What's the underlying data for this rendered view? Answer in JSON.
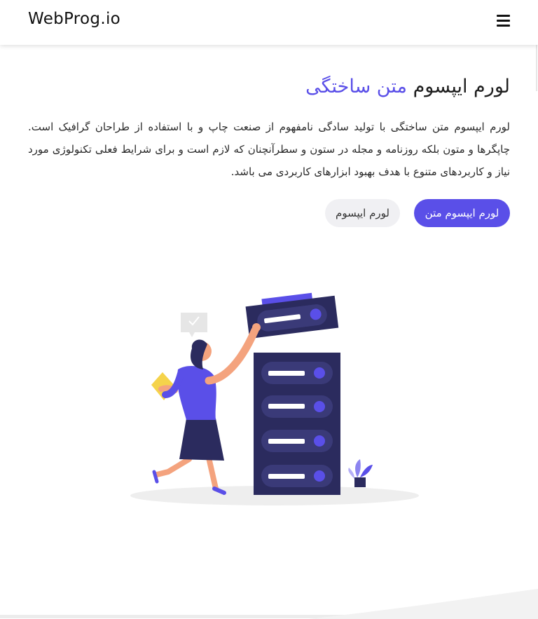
{
  "header": {
    "logo": "WebProg.io",
    "menu_icon": "hamburger-menu-icon"
  },
  "hero": {
    "title_main": "لورم ایپسوم",
    "title_accent": "متن ساختگی",
    "paragraph": "لورم ایپسوم متن ساختگی با تولید سادگی نامفهوم از صنعت چاپ و با استفاده از طراحان گرافیک است. چاپگرها و متون بلکه روزنامه و مجله در ستون و سطرآنچنان که لازم است و برای شرایط فعلی تکنولوژی مورد نیاز و کاربردهای متنوع با هدف بهبود ابزارهای کاربردی می باشد.",
    "primary_button": "لورم ایپسوم متن",
    "secondary_button": "لورم ایپسوم"
  },
  "colors": {
    "accent": "#5a4fe8",
    "dark_navy": "#2b2b5e",
    "skin": "#f4a37e",
    "yellow": "#f5d34b"
  },
  "illustration": {
    "name": "woman-arranging-server-rack-illustration"
  }
}
